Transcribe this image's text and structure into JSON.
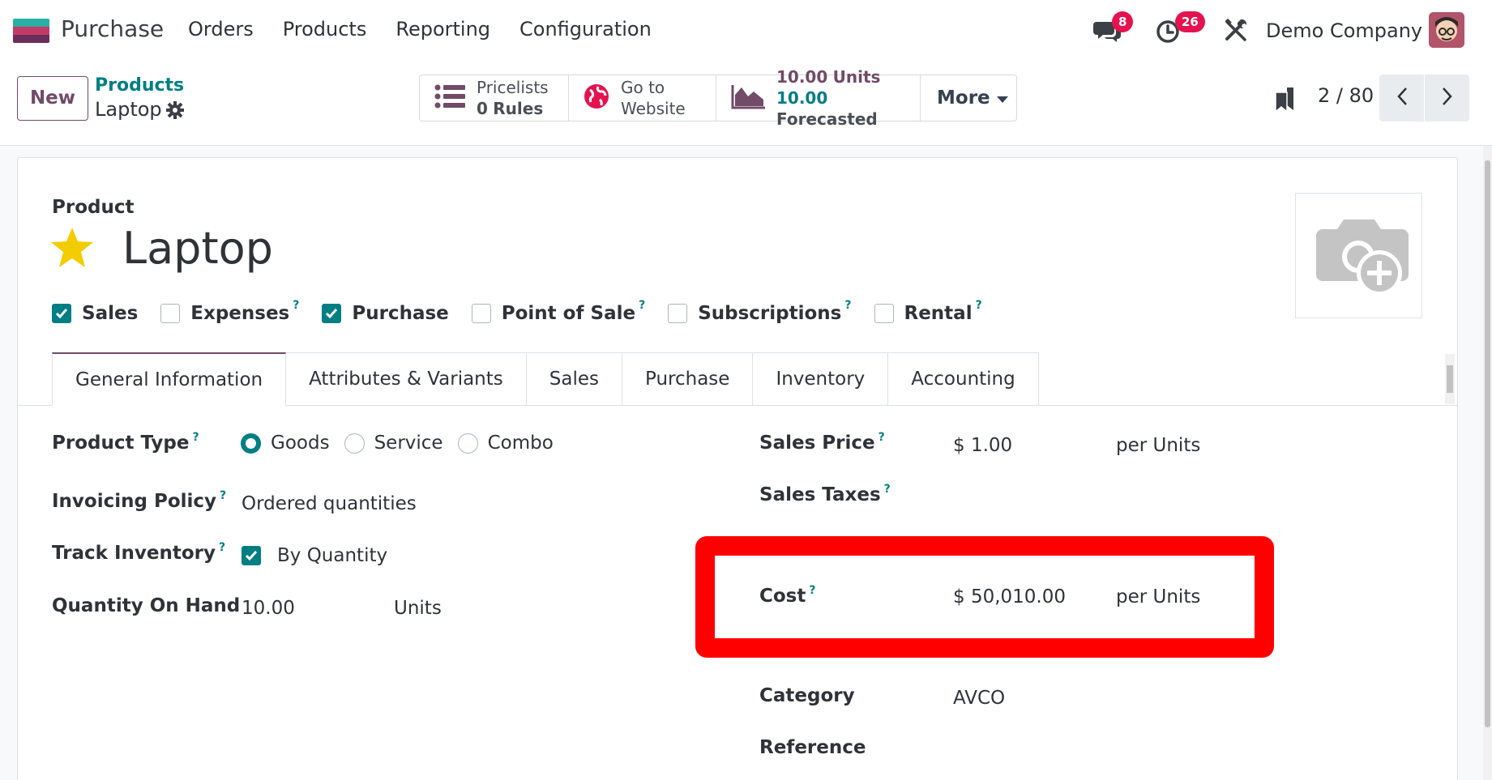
{
  "navbar": {
    "app_name": "Purchase",
    "menu": [
      "Orders",
      "Products",
      "Reporting",
      "Configuration"
    ],
    "messages_badge": "8",
    "activities_badge": "26",
    "company": "Demo Company",
    "icons": [
      "app-logo",
      "chat-icon",
      "clock-icon",
      "tools-icon",
      "avatar"
    ]
  },
  "control": {
    "new_label": "New",
    "breadcrumb_parent": "Products",
    "breadcrumb_current": "Laptop",
    "smart_buttons": {
      "pricelists_label": "Pricelists",
      "pricelists_value": "0",
      "pricelists_unit": "Rules",
      "website_line1": "Go to",
      "website_line2": "Website",
      "units_value": "10.00",
      "units_label": "Units",
      "forecast_value": "10.00",
      "forecast_label": "Forecasted",
      "more_label": "More"
    },
    "pager": "2 / 80"
  },
  "form": {
    "title_label": "Product",
    "name": "Laptop",
    "favorite_color": "#f3cc00",
    "checkboxes": [
      {
        "label": "Sales",
        "checked": true,
        "help": false
      },
      {
        "label": "Expenses",
        "checked": false,
        "help": true
      },
      {
        "label": "Purchase",
        "checked": true,
        "help": false
      },
      {
        "label": "Point of Sale",
        "checked": false,
        "help": true
      },
      {
        "label": "Subscriptions",
        "checked": false,
        "help": true
      },
      {
        "label": "Rental",
        "checked": false,
        "help": true
      }
    ],
    "help_mark": "?",
    "tabs": [
      "General Information",
      "Attributes & Variants",
      "Sales",
      "Purchase",
      "Inventory",
      "Accounting"
    ],
    "active_tab": "General Information",
    "fields": {
      "product_type_label": "Product Type",
      "product_type_options": [
        "Goods",
        "Service",
        "Combo"
      ],
      "product_type_selected": "Goods",
      "invoicing_policy_label": "Invoicing Policy",
      "invoicing_policy_value": "Ordered quantities",
      "track_inventory_label": "Track Inventory",
      "track_inventory_value": "By Quantity",
      "qty_on_hand_label": "Quantity On Hand",
      "qty_on_hand_value": "10.00",
      "qty_on_hand_uom": "Units",
      "sales_price_label": "Sales Price",
      "sales_price_value": "$ 1.00",
      "sales_price_uom": "per Units",
      "sales_taxes_label": "Sales Taxes",
      "cost_label": "Cost",
      "cost_value": "$ 50,010.00",
      "cost_uom": "per Units",
      "category_label": "Category",
      "category_value": "AVCO",
      "reference_label": "Reference"
    }
  },
  "colors": {
    "brand": "#714b67",
    "accent": "#017e84",
    "badge": "#e4134f",
    "highlight": "#ff0000"
  }
}
